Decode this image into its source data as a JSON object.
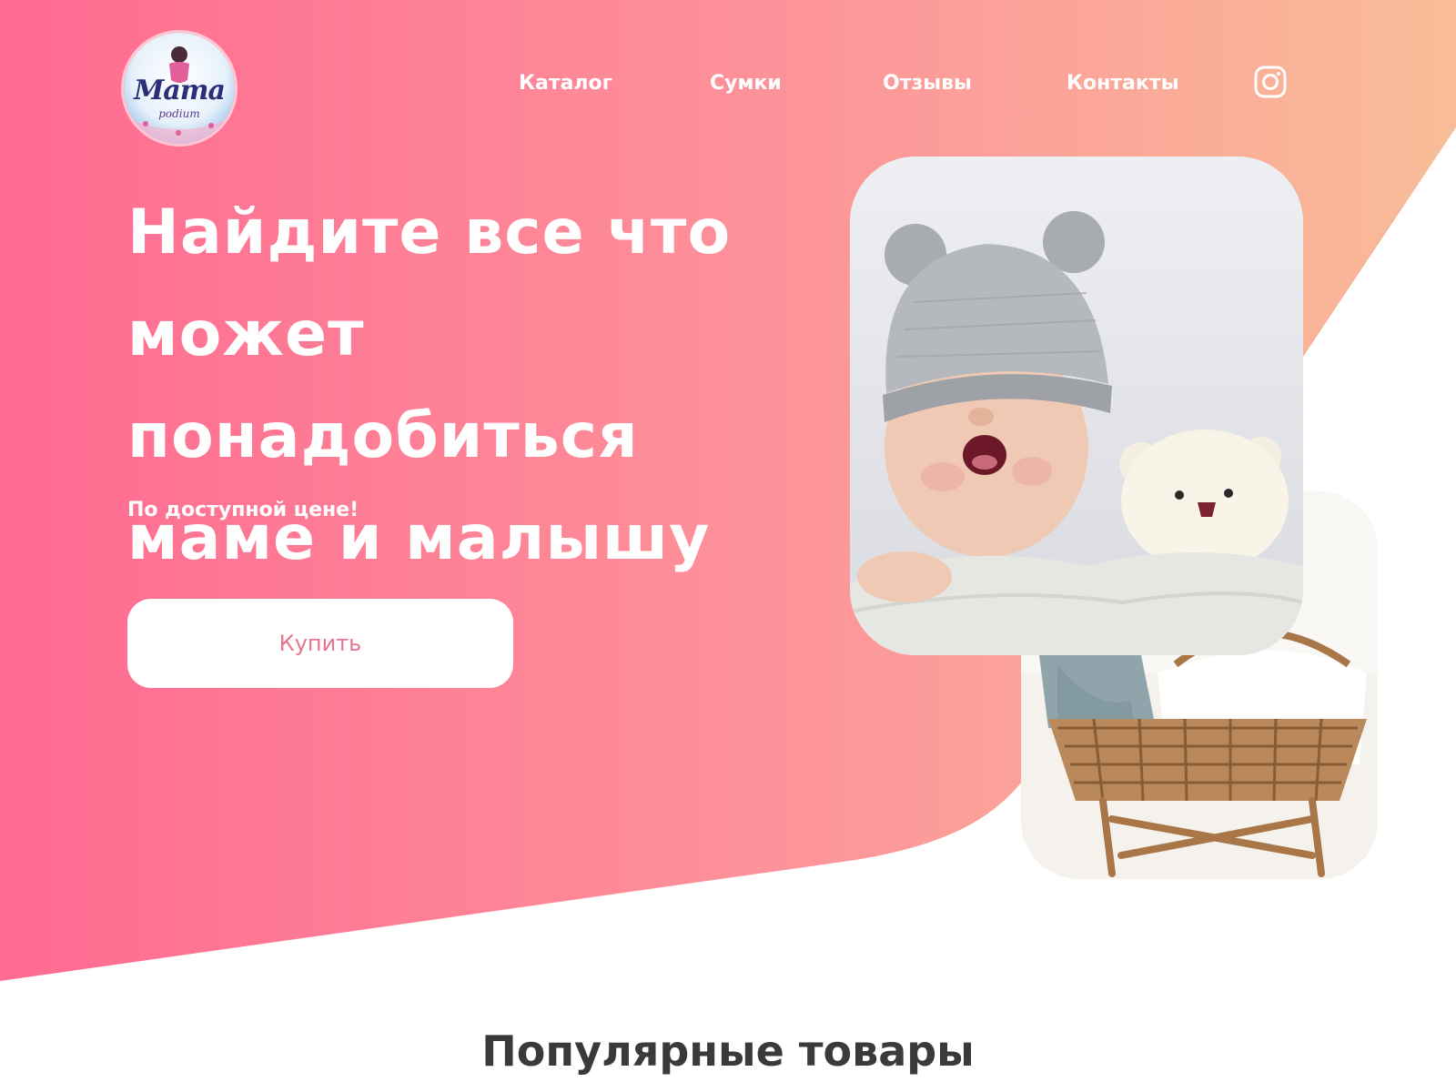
{
  "brand": {
    "logo_text": "Mama",
    "logo_subtext": "podium"
  },
  "nav": {
    "items": [
      {
        "label": "Каталог"
      },
      {
        "label": "Сумки"
      },
      {
        "label": "Отзывы"
      },
      {
        "label": "Контакты"
      }
    ],
    "social_icon": "instagram-icon"
  },
  "hero": {
    "title_line1": "Найдите все что",
    "title_line2": "может понадобиться",
    "title_line3": "маме и малышу",
    "subtitle": "По доступной цене!",
    "cta_label": "Купить",
    "photos": [
      {
        "name": "baby-yawning-photo"
      },
      {
        "name": "wicker-cradle-photo"
      }
    ]
  },
  "sections": {
    "popular_title": "Популярные товары"
  },
  "colors": {
    "gradient_start": "#ff6b92",
    "gradient_end": "#f9b99a",
    "button_text": "#e8748f",
    "heading_dark": "#3a3a3a"
  }
}
